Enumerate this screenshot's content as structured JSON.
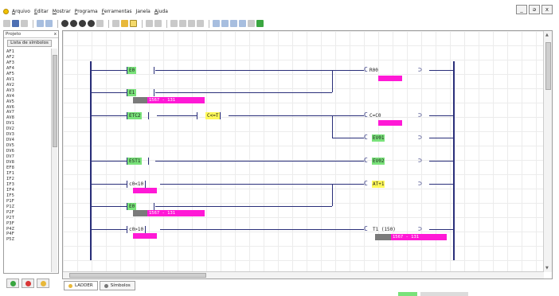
{
  "menu": {
    "items": [
      "Arquivo",
      "Editar",
      "Mostrar",
      "Programa",
      "Ferramentas",
      "Janela",
      "Ajuda"
    ]
  },
  "window_controls": {
    "minimize": "_",
    "restore": "ə",
    "close": "x"
  },
  "left_panel": {
    "title": "Projeto",
    "close": "x",
    "header": "Lista de símbolos",
    "symbols": [
      "AF1",
      "AF2",
      "AF3",
      "AF4",
      "AF5",
      "AV1",
      "AV2",
      "AV3",
      "AV4",
      "AV5",
      "AV6",
      "AV7",
      "AV8",
      "DV1",
      "DV2",
      "DV3",
      "DV4",
      "DV5",
      "DV6",
      "DV7",
      "DV8",
      "EF8",
      "IF1",
      "IF2",
      "IF3",
      "IF4",
      "IF5",
      "P1F",
      "P1Z",
      "P2F",
      "P2T",
      "P3F",
      "P4Z",
      "P4F",
      "P5Z"
    ]
  },
  "rungs": {
    "r1": {
      "contact": "E0",
      "coil": "R00"
    },
    "r2": {
      "contact": "E1",
      "address": "1567 - 131"
    },
    "r3": {
      "contact": "ETC2",
      "contact2": "C<=T",
      "coil": "C=C0",
      "coil2": "EV01"
    },
    "r4": {
      "contact": "EST1",
      "coil": "EV02"
    },
    "r5": {
      "contact": "c0<10",
      "coil": "AT+1"
    },
    "r6": {
      "contact": "E0",
      "address": "1567 - 131"
    },
    "r7": {
      "contact": "c0>10",
      "coil": "T1 (150)",
      "address": "1567 - 131"
    }
  },
  "doc_tabs": [
    "LADDER",
    "Símbolos"
  ],
  "colors": {
    "wire": "#2a2f7a",
    "contact_green": "#79e27a",
    "highlight_yellow": "#fff95a",
    "magenta": "#ff19d6",
    "address_gray": "#7a7a7a"
  }
}
